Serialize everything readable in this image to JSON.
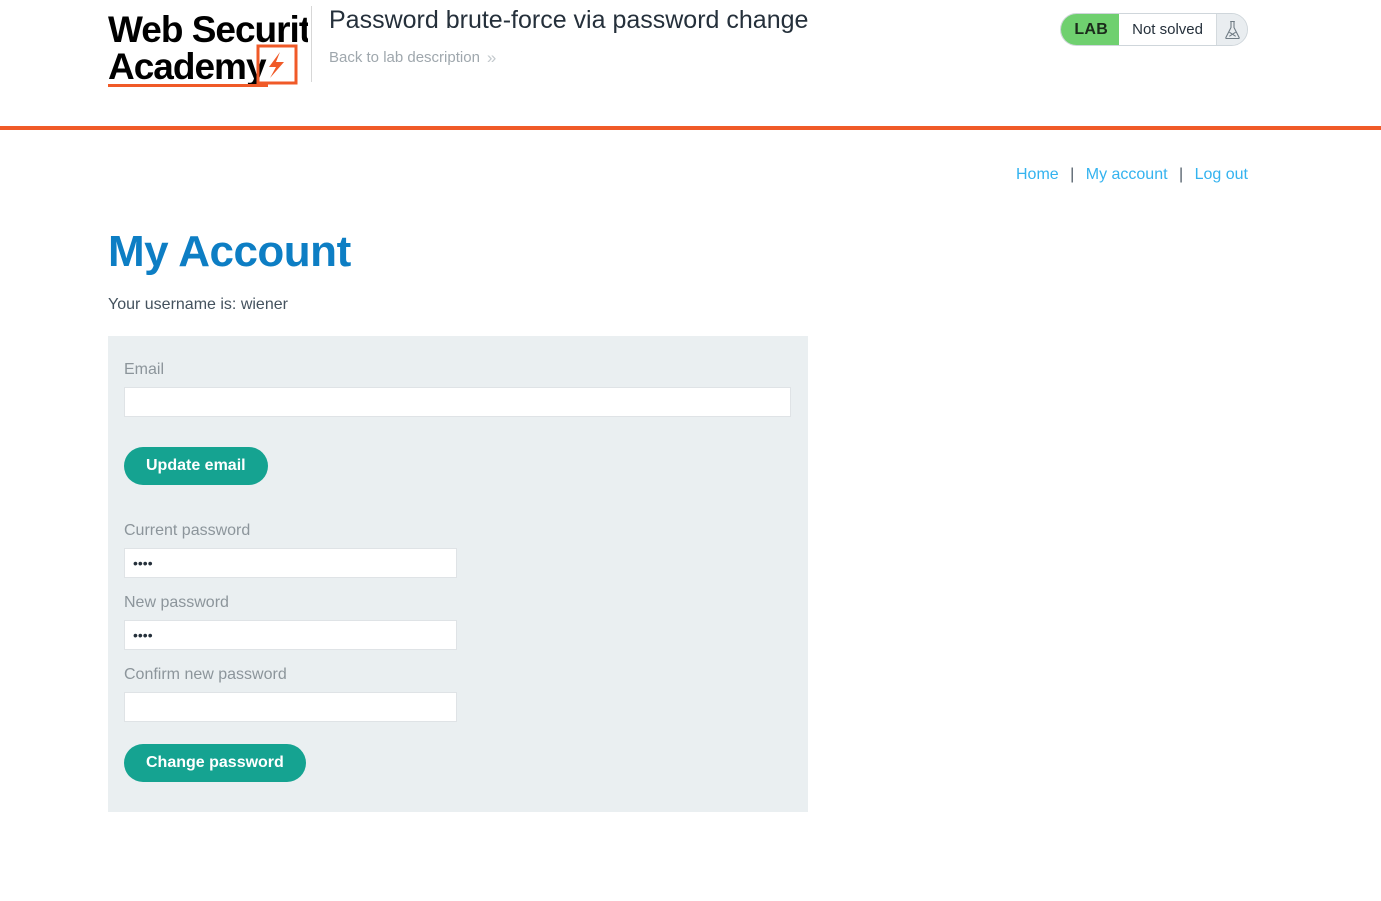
{
  "lab_header": {
    "logo": {
      "line1": "Web Security",
      "line2": "Academy",
      "icon": "lightning-bolt-icon"
    },
    "title": "Password brute-force via password change",
    "back_link": "Back to lab description",
    "back_link_icon": "double-chevron-right-icon",
    "status": {
      "tag": "LAB",
      "state": "Not solved",
      "icon": "flask-not-solved-icon",
      "tag_color": "#6fd06f",
      "accent_color": "#f05a28"
    }
  },
  "topnav": {
    "items": [
      {
        "label": "Home"
      },
      {
        "label": "My account"
      },
      {
        "label": "Log out"
      }
    ],
    "separator": "|"
  },
  "main": {
    "page_title": "My Account",
    "username_line": "Your username is: wiener",
    "form": {
      "email": {
        "label": "Email",
        "value": "",
        "placeholder": ""
      },
      "update_email_button": "Update email",
      "current_password": {
        "label": "Current password",
        "value": "••••"
      },
      "new_password": {
        "label": "New password",
        "value": "••••"
      },
      "confirm_password": {
        "label": "Confirm new password",
        "value": ""
      },
      "change_password_button": "Change password"
    }
  }
}
